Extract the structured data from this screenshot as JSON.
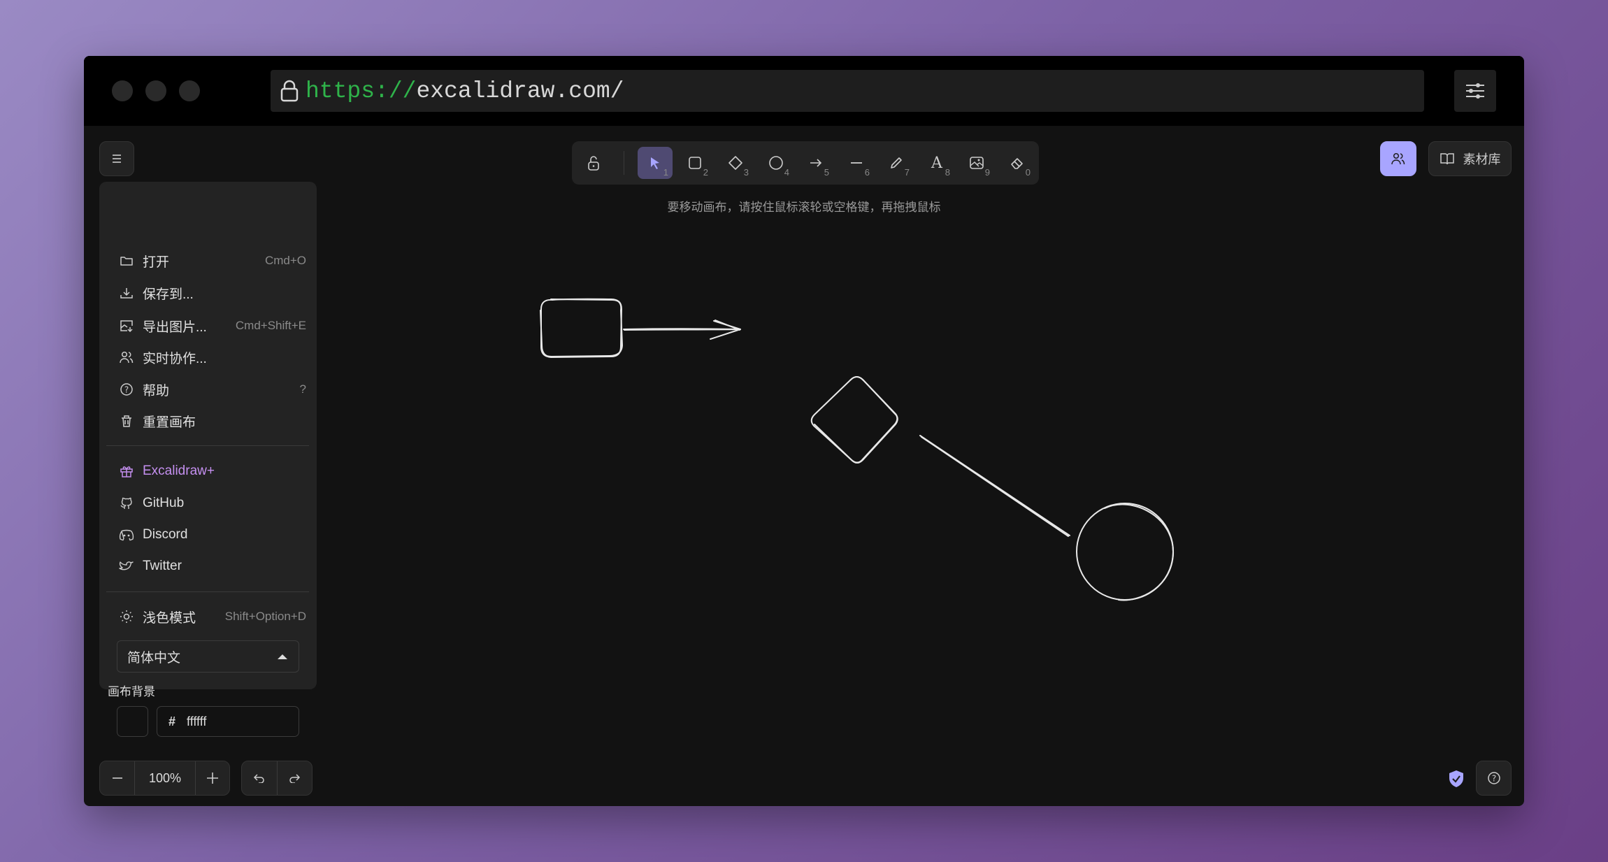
{
  "browser": {
    "url_protocol": "https://",
    "url_rest": "excalidraw.com/"
  },
  "toolbar": {
    "tools": [
      {
        "name": "selection",
        "key": "1",
        "selected": true
      },
      {
        "name": "rectangle",
        "key": "2"
      },
      {
        "name": "diamond",
        "key": "3"
      },
      {
        "name": "ellipse",
        "key": "4"
      },
      {
        "name": "arrow",
        "key": "5"
      },
      {
        "name": "line",
        "key": "6"
      },
      {
        "name": "draw",
        "key": "7"
      },
      {
        "name": "text",
        "key": "8"
      },
      {
        "name": "image",
        "key": "9"
      },
      {
        "name": "eraser",
        "key": "0"
      }
    ],
    "text_glyph": "A"
  },
  "hint": "要移动画布，请按住鼠标滚轮或空格键，再拖拽鼠标",
  "top_right": {
    "library_label": "素材库"
  },
  "menu": {
    "items": [
      {
        "label": "打开",
        "shortcut": "Cmd+O",
        "icon": "folder-icon"
      },
      {
        "label": "保存到...",
        "shortcut": "",
        "icon": "download-icon"
      },
      {
        "label": "导出图片...",
        "shortcut": "Cmd+Shift+E",
        "icon": "export-image-icon"
      },
      {
        "label": "实时协作...",
        "shortcut": "",
        "icon": "users-icon"
      },
      {
        "label": "帮助",
        "shortcut": "?",
        "icon": "help-icon"
      },
      {
        "label": "重置画布",
        "shortcut": "",
        "icon": "trash-icon"
      }
    ],
    "links": [
      {
        "label": "Excalidraw+",
        "icon": "gift-icon"
      },
      {
        "label": "GitHub",
        "icon": "github-icon"
      },
      {
        "label": "Discord",
        "icon": "discord-icon"
      },
      {
        "label": "Twitter",
        "icon": "twitter-icon"
      }
    ],
    "theme": {
      "label": "浅色模式",
      "shortcut": "Shift+Option+D"
    },
    "language": "简体中文",
    "canvas_bg_label": "画布背景",
    "canvas_bg_hash": "#",
    "canvas_bg_value": "ffffff"
  },
  "footer": {
    "zoom": "100%"
  },
  "colors": {
    "accent": "#a8a5ff",
    "excalidraw_plus": "#c590f0",
    "url_green": "#2fb34a",
    "canvas": "#121212"
  }
}
